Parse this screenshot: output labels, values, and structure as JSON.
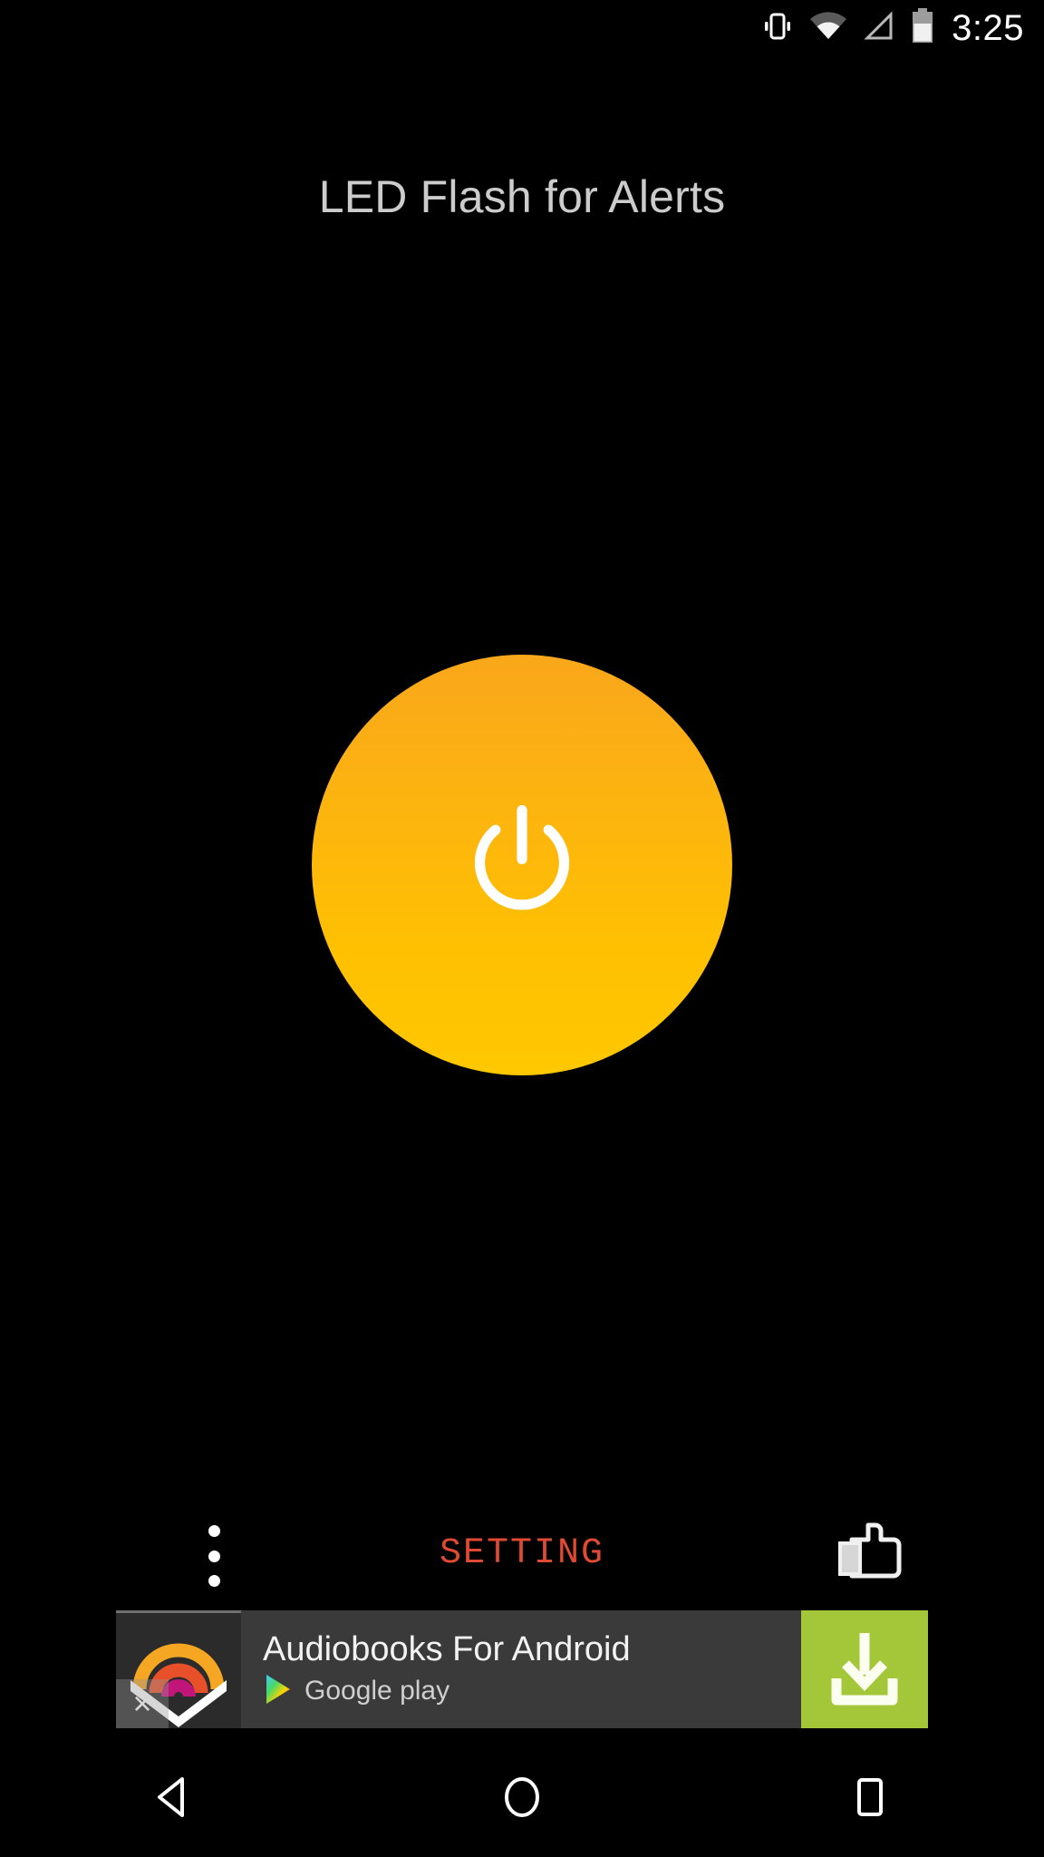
{
  "status_bar": {
    "vibrate_icon": "vibrate-icon",
    "wifi_icon": "wifi-icon",
    "cellular_icon": "cellular-signal-icon",
    "battery_icon": "battery-icon",
    "time": "3:25"
  },
  "app": {
    "title": "LED Flash for Alerts",
    "title_color": "#cccccc",
    "background_color": "#000000"
  },
  "power_button": {
    "icon": "power-icon",
    "state": "on",
    "gradient_top_color": "#f9a71b",
    "gradient_bottom_color": "#ffc800",
    "glyph_color": "#ffffff"
  },
  "controls": {
    "overflow_label": "overflow-menu",
    "setting_label": "SETTING",
    "setting_color": "#e04a33",
    "like_label": "thumbs-up-icon"
  },
  "ad": {
    "headline": "Audiobooks For Android",
    "store_label": "Google play",
    "close_label": "×",
    "cta_icon": "download-icon",
    "cta_color": "#a4c639",
    "banner_background": "#3a3a3a",
    "icon_tile_background": "#2b2b2b",
    "icon_arc_colors": [
      "#f5a623",
      "#e8502a",
      "#c2157a"
    ]
  },
  "nav_bar": {
    "back_label": "back-button",
    "home_label": "home-button",
    "recents_label": "recents-button"
  }
}
